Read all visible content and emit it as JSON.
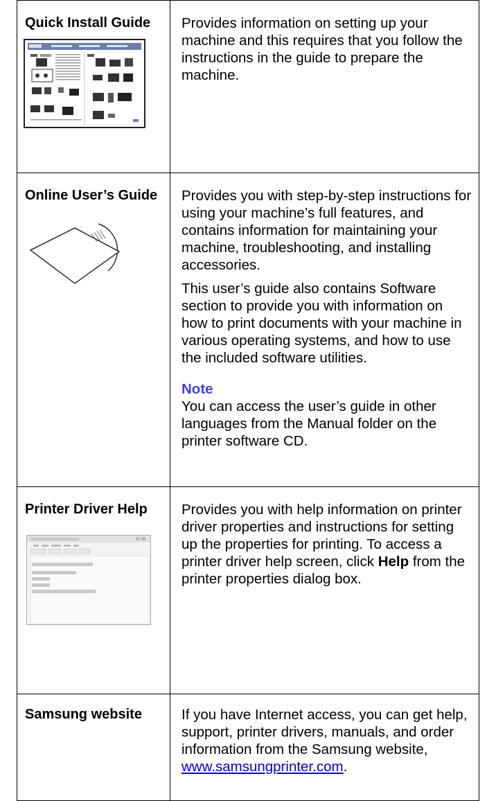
{
  "rows": [
    {
      "title": "Quick Install Guide",
      "paragraphs": [
        "Provides information on setting up your machine and this requires that you follow the instructions in the guide to prepare the machine."
      ],
      "image": "quick-install-guide-thumbnail"
    },
    {
      "title": "Online User’s Guide",
      "paragraphs": [
        "Provides you with step-by-step instructions for using your machine’s full features, and contains information for maintaining your machine, troubleshooting, and installing accessories.",
        "This user’s guide also contains Software section to provide you with information on how to print documents with your machine in various operating systems, and how to use the included software utilities."
      ],
      "note_heading": "Note",
      "note_text": "You can access the user’s guide in other languages from the Manual folder on the printer software CD.",
      "image": "cd-disc-icon"
    },
    {
      "title": "Printer Driver Help",
      "text_before": "Provides you with help information on printer driver properties and instructions for setting up the properties for printing. To access a printer driver help screen, click ",
      "text_bold": "Help",
      "text_after": " from the printer properties dialog box.",
      "image": "driver-help-screen-thumbnail"
    },
    {
      "title": "Samsung website",
      "text_before": "If you have Internet access, you can get help, support, printer drivers, manuals, and order information from the Samsung website, ",
      "link_text": "www.samsungprinter.com",
      "text_after": "."
    }
  ]
}
